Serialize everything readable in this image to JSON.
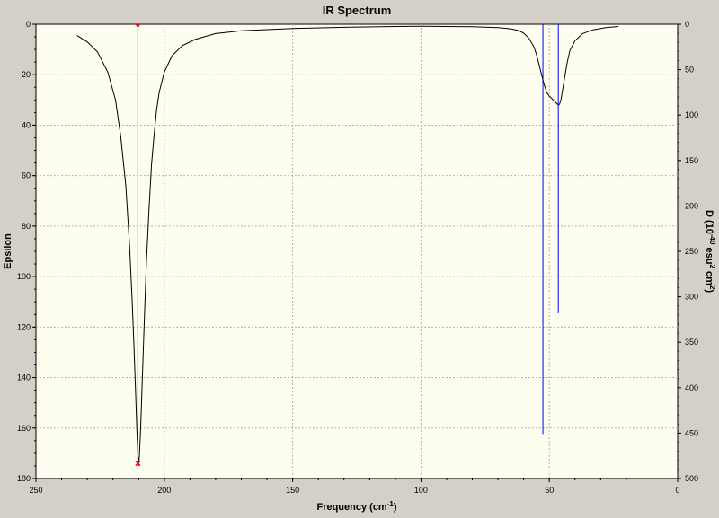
{
  "chart_data": {
    "type": "line",
    "title": "IR Spectrum",
    "xlabel": "Frequency (cm",
    "xlabel_sup": "-1",
    "xlabel_close": ")",
    "ylabel_left": "Epsilon",
    "ylabel_right": {
      "prefix": "D (10",
      "sup1": "-40",
      "mid": " esu",
      "sup2": "2",
      "mid2": " cm",
      "sup3": "2",
      "suffix": ")"
    },
    "xlim": [
      250,
      0
    ],
    "ylim_left": [
      0,
      180
    ],
    "ylim_right": [
      0,
      500
    ],
    "x_ticks": [
      "250",
      "200",
      "150",
      "100",
      "50",
      "0"
    ],
    "left_ticks": [
      "0",
      "20",
      "40",
      "60",
      "80",
      "100",
      "120",
      "140",
      "160",
      "180"
    ],
    "right_ticks": [
      "0",
      "50",
      "100",
      "150",
      "200",
      "250",
      "300",
      "350",
      "400",
      "450",
      "500"
    ],
    "grid": true,
    "colors": {
      "plot_background": "#fdfdf0",
      "window_background": "#d4d0c8",
      "grid": "#b4b4b4",
      "spectrum": "#000000",
      "sticks": "#0000ff",
      "markers": "#ff0000"
    },
    "spectrum": {
      "x": [
        234,
        230,
        226,
        222,
        219,
        217,
        215,
        213.5,
        212.5,
        211.8,
        211.2,
        210.7,
        210.3,
        210,
        209.7,
        209.2,
        208.6,
        207.8,
        207,
        206,
        205,
        204,
        203,
        202,
        200,
        197,
        193,
        188,
        180,
        170,
        150,
        130,
        110,
        100,
        80,
        70,
        65,
        62,
        60,
        58,
        56,
        55,
        54,
        53,
        52,
        51,
        50,
        49,
        48.5,
        48,
        47.5,
        47,
        46.5,
        46,
        45.5,
        45,
        44,
        43,
        42,
        40,
        37,
        33,
        28,
        23
      ],
      "y": [
        4.5,
        7,
        11,
        19,
        30,
        44,
        64,
        88,
        110,
        128,
        145,
        160,
        170,
        175,
        171,
        160,
        142,
        118,
        95,
        74,
        56,
        44,
        34,
        27,
        19,
        12.5,
        8.5,
        6,
        3.7,
        2.6,
        1.7,
        1.2,
        0.9,
        0.8,
        1,
        1.3,
        1.8,
        2.5,
        3.5,
        5.5,
        9,
        12,
        16,
        20,
        24,
        27,
        28.5,
        29.5,
        30,
        30.5,
        31,
        31.5,
        32.1,
        31.7,
        30,
        27,
        21,
        15,
        10.5,
        6.5,
        3.7,
        2.2,
        1.3,
        0.9
      ]
    },
    "sticks": [
      {
        "x": 210.3,
        "d": 490
      },
      {
        "x": 52.5,
        "d": 451
      },
      {
        "x": 46.5,
        "d": 318
      }
    ],
    "markers": [
      {
        "x": 210.3,
        "y": 0
      },
      {
        "x": 210.3,
        "y": 174
      }
    ]
  }
}
